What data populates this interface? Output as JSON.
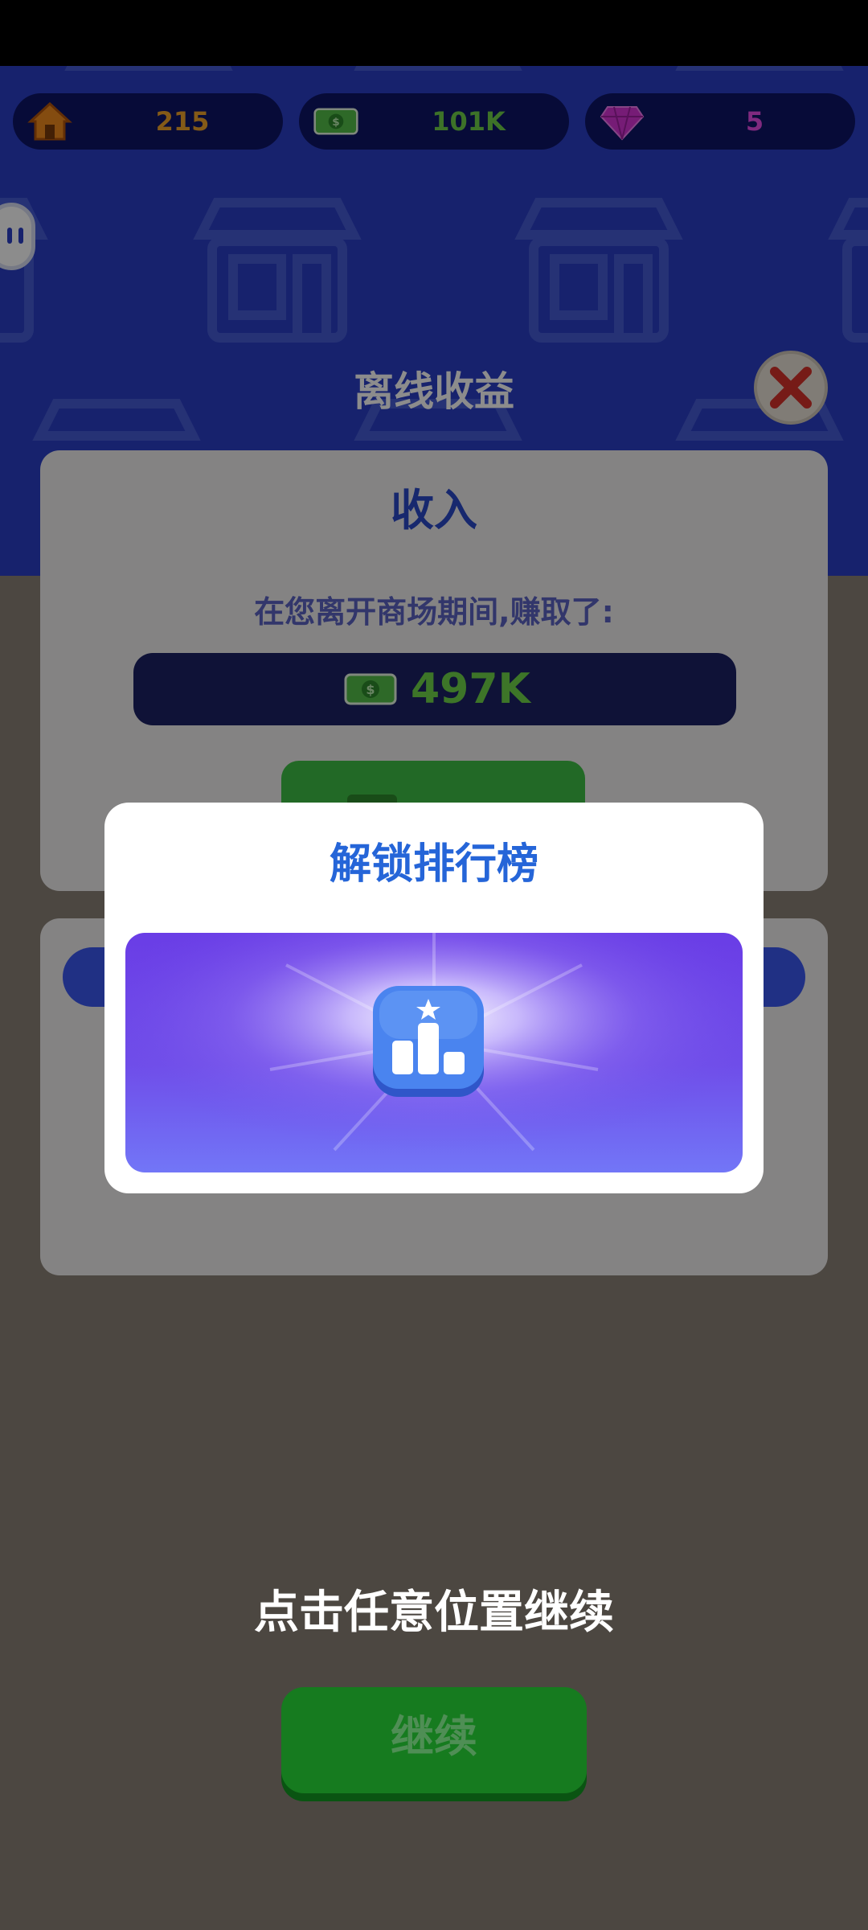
{
  "resources": {
    "homes": {
      "value": "215",
      "icon": "house-icon",
      "color": "#f0a52a"
    },
    "cash": {
      "value": "101K",
      "icon": "cash-icon",
      "color": "#6fcf4a"
    },
    "gems": {
      "value": "5",
      "icon": "gem-icon",
      "color": "#e94ee8"
    }
  },
  "offline": {
    "title": "离线收益",
    "income_title": "收入",
    "earned_text": "在您离开商场期间,赚取了:",
    "amount": "497K"
  },
  "unlock": {
    "title": "解锁排行榜",
    "icon": "leaderboard-icon"
  },
  "continue_hint": "点击任意位置继续",
  "continue_button": "继续",
  "colors": {
    "header_blue": "#2a3fc7",
    "dialog_title": "#2565d8",
    "continue_green": "#167b1f"
  }
}
